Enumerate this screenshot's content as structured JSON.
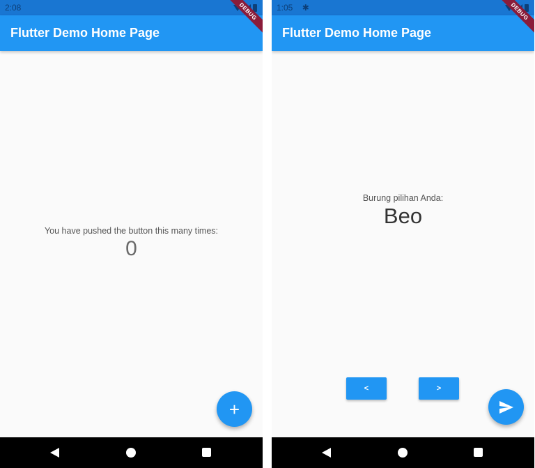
{
  "left": {
    "status_time": "2:08",
    "app_bar_title": "Flutter Demo Home Page",
    "debug_label": "DEBUG",
    "label": "You have pushed the button this many times:",
    "counter": "0",
    "fab_icon": "+"
  },
  "right": {
    "status_time": "1:05",
    "status_extra_icon": "gear-icon",
    "app_bar_title": "Flutter Demo Home Page",
    "debug_label": "DEBUG",
    "label": "Burung pilihan Anda:",
    "bird_name": "Beo",
    "prev_button": "<",
    "next_button": ">",
    "fab_icon": "send-icon"
  },
  "colors": {
    "primary": "#2196f3",
    "status_bar": "#1976d2",
    "background": "#fafafa",
    "nav_bar": "#000000",
    "debug_ribbon": "#8a1c3a"
  }
}
